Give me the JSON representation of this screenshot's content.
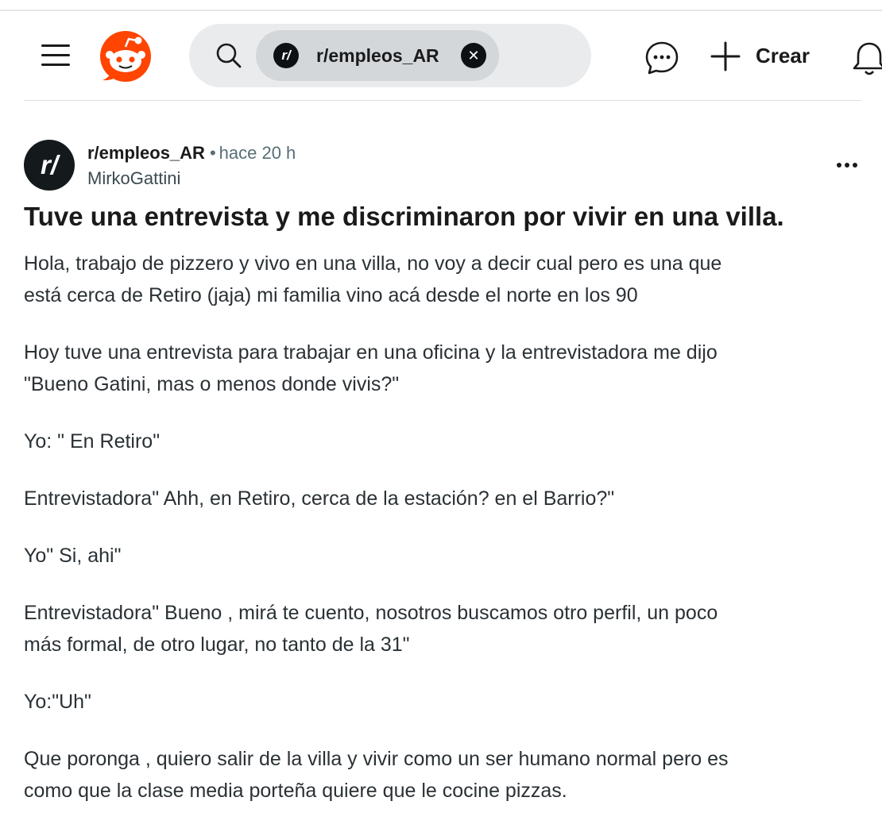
{
  "header": {
    "search": {
      "community_chip": "r/empleos_AR",
      "community_avatar": "r/"
    },
    "create_label": "Crear",
    "icons": [
      "menu-icon",
      "reddit-logo",
      "search-icon",
      "close-icon",
      "chat-icon",
      "plus-icon",
      "bell-icon"
    ]
  },
  "post": {
    "subreddit": "r/empleos_AR",
    "avatar": "r/",
    "separator": "•",
    "time": "hace 20 h",
    "author": "MirkoGattini",
    "title": "Tuve una entrevista y me discriminaron por vivir en una villa.",
    "paragraphs": [
      "Hola, trabajo de pizzero y vivo en una villa, no voy a decir cual pero es una que\nestá cerca de Retiro (jaja) mi familia vino acá desde el norte en los 90",
      "Hoy tuve una entrevista para trabajar en una oficina y la entrevistadora me dijo\n\"Bueno Gatini, mas o menos donde vivis?\"",
      "Yo: \" En Retiro\"",
      "Entrevistadora\" Ahh, en Retiro, cerca de la estación? en el Barrio?\"",
      "Yo\" Si, ahi\"",
      "Entrevistadora\" Bueno , mirá te cuento, nosotros buscamos otro perfil, un poco\nmás formal, de otro lugar, no tanto de la 31\"",
      "Yo:\"Uh\"",
      "Que poronga , quiero salir de la villa y vivir como un ser humano normal pero es\ncomo que la clase media porteña quiere que le cocine pizzas."
    ]
  },
  "colors": {
    "reddit_orange": "#ff4500",
    "search_bg": "#e9ebed",
    "chip_bg": "#d3d7da",
    "meta_gray": "#576f76"
  }
}
